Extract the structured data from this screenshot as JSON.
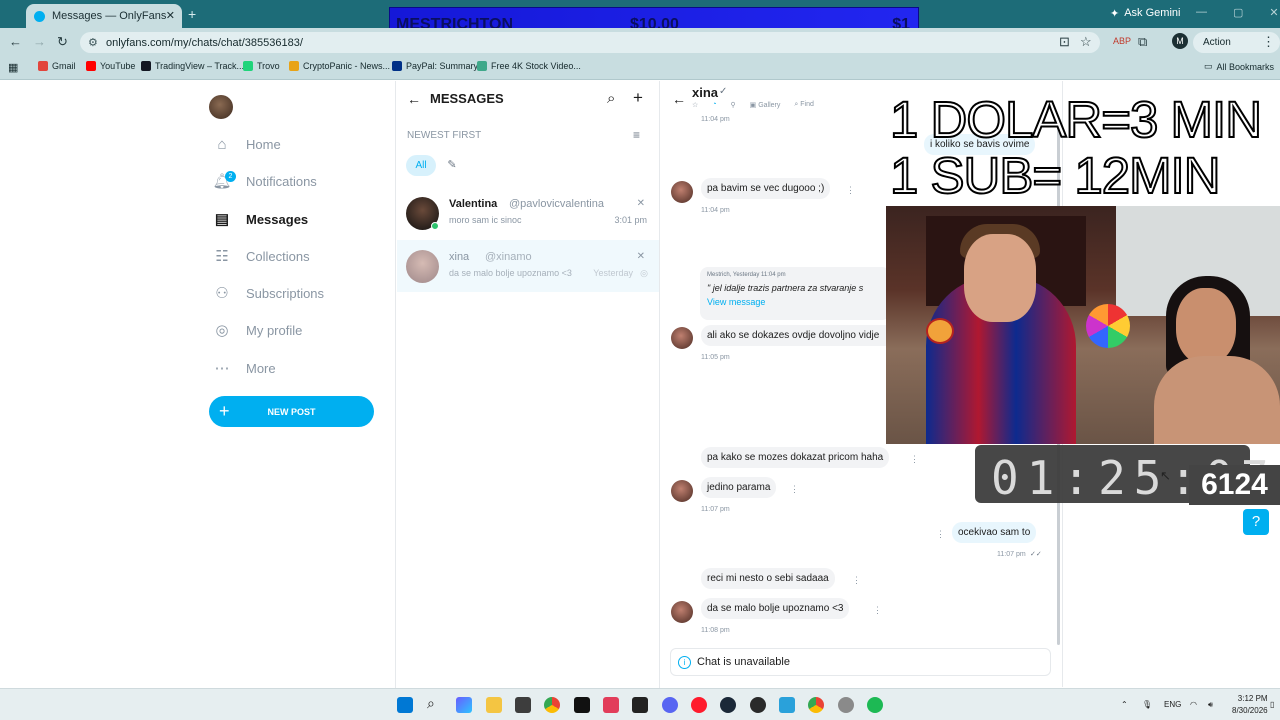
{
  "browser": {
    "tab_title": "Messages — OnlyFans",
    "tab_close": "✕",
    "new_tab": "+",
    "ask_gemini": "Ask Gemini",
    "url": "onlyfans.com/my/chats/chat/385536183/",
    "profile_initial": "M",
    "action_required": "Action required",
    "bookmarks": [
      "Gmail",
      "YouTube",
      "TradingView – Track...",
      "Trovo",
      "CryptoPanic - News...",
      "PayPal: Summary",
      "Free 4K Stock Video..."
    ],
    "all_bookmarks": "All Bookmarks"
  },
  "banner": {
    "name": "MESTRICHTON",
    "amount": "$10.00",
    "right": "$1"
  },
  "sidebar": {
    "items": [
      {
        "label": "Home",
        "icon": "home-icon"
      },
      {
        "label": "Notifications",
        "icon": "bell-icon"
      },
      {
        "label": "Messages",
        "icon": "message-icon"
      },
      {
        "label": "Collections",
        "icon": "collections-icon"
      },
      {
        "label": "Subscriptions",
        "icon": "subscriptions-icon"
      },
      {
        "label": "My profile",
        "icon": "profile-icon"
      },
      {
        "label": "More",
        "icon": "more-icon"
      }
    ],
    "notification_count": "2",
    "new_post": "NEW POST"
  },
  "messages": {
    "title": "MESSAGES",
    "sort_label": "NEWEST FIRST",
    "filter_all": "All",
    "conversations": [
      {
        "name": "Valentina",
        "handle": "@pavlovicvalentina",
        "preview": "moro sam ic sinoc",
        "time": "3:01 pm"
      },
      {
        "name": "xina",
        "handle": "@xinamo",
        "preview": "da se malo bolje upoznamo <3",
        "time": "Yesterday"
      }
    ]
  },
  "chat": {
    "name": "xina",
    "tools": [
      "Gallery",
      "Find"
    ],
    "messages": [
      {
        "text": "i koliko se bavis ovime",
        "time": "11:04 pm",
        "from": "me"
      },
      {
        "text": "pa bavim se vec dugooo ;)",
        "time": "11:04 pm",
        "from": "them"
      },
      {
        "quote_meta": "Mestrich, Yesterday 11:04 pm",
        "quote_text": "\" jel idalje trazis partnera za stvaranje s",
        "view": "View message"
      },
      {
        "text": "ali ako se dokazes ovdje dovoljno vidje",
        "time": "11:05 pm",
        "from": "them"
      },
      {
        "text": "pa kako se mozes dokazat pricom haha",
        "from": "them"
      },
      {
        "text": "jedino parama",
        "time": "11:07 pm",
        "from": "them"
      },
      {
        "text": "ocekivao sam to",
        "time": "11:07 pm",
        "from": "me"
      },
      {
        "text": "reci mi nesto o sebi sadaaa",
        "from": "them"
      },
      {
        "text": "da se malo bolje upoznamo <3",
        "time": "11:08 pm",
        "from": "them"
      }
    ],
    "unavailable": "Chat is unavailable"
  },
  "overlay": {
    "line1": "1 DOLAR=3 MIN",
    "line2": "1 SUB= 12MIN",
    "timer": "01:25:07",
    "subs": "6124"
  },
  "taskbar": {
    "lang": "ENG",
    "time": "3:12 PM",
    "date": "8/30/2026"
  }
}
